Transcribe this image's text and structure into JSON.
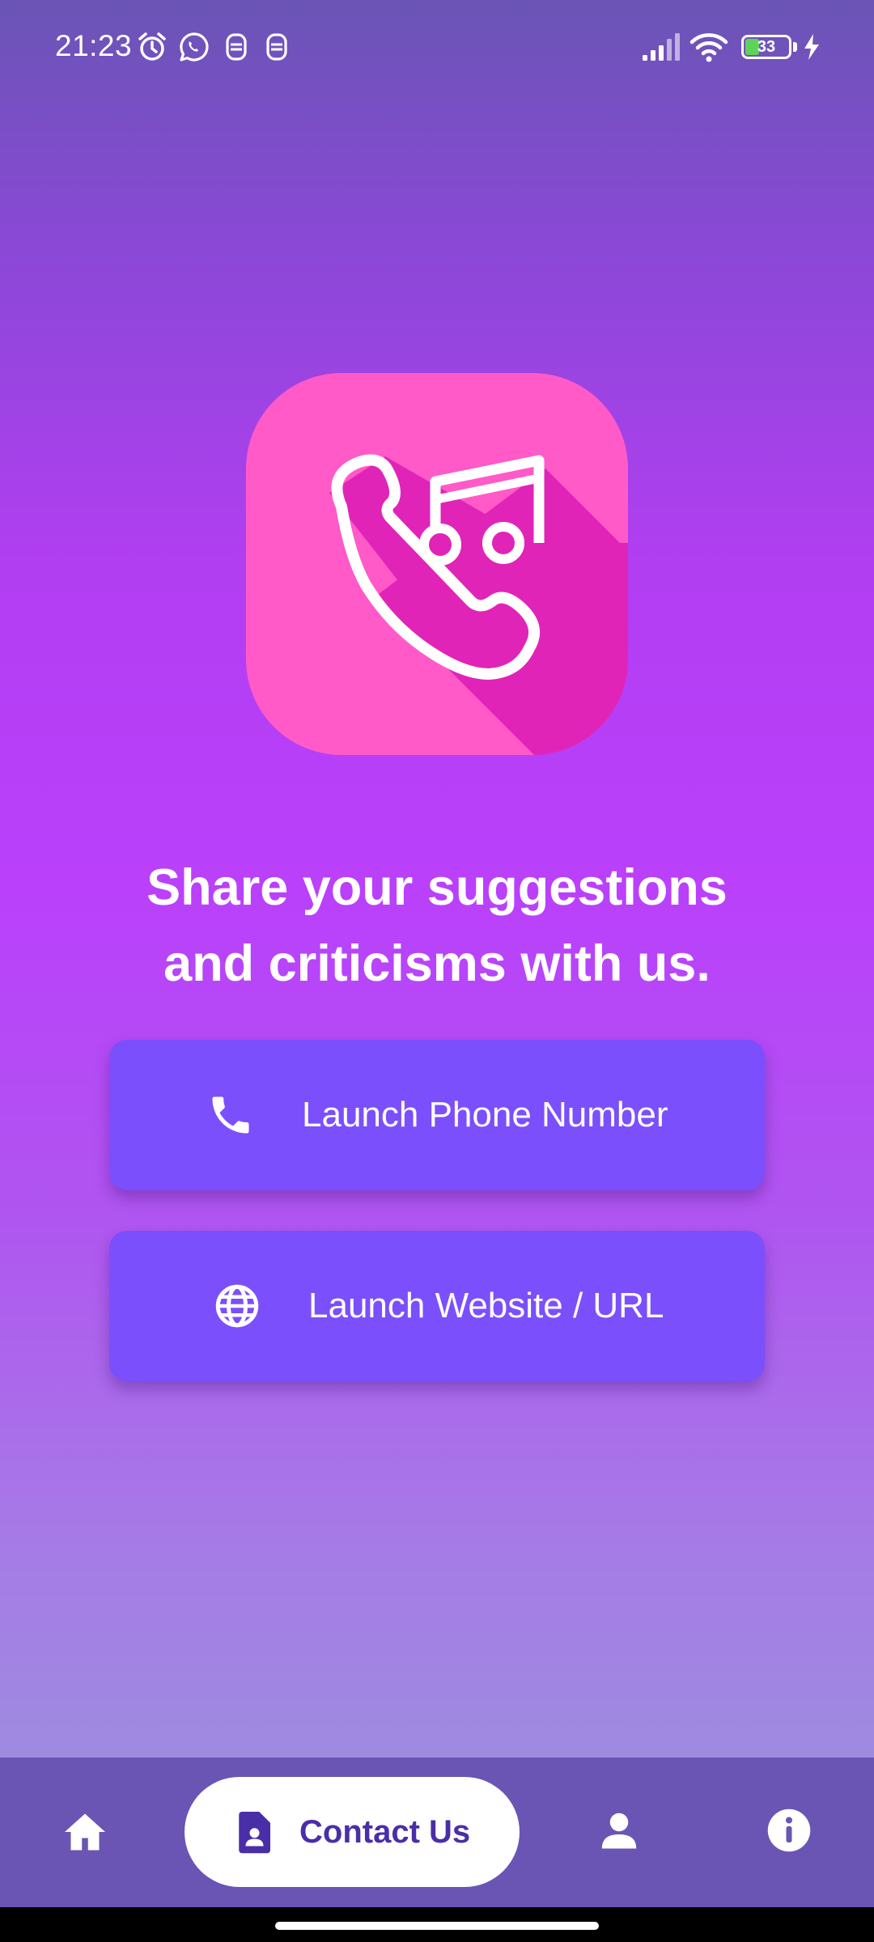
{
  "status_bar": {
    "time": "21:23",
    "battery_level": "33",
    "icons": [
      "alarm-icon",
      "whatsapp-icon",
      "sim-icon",
      "sim-icon",
      "signal-icon",
      "wifi-icon",
      "battery-icon",
      "charging-icon"
    ]
  },
  "app": {
    "logo_icon": "phone-music-logo"
  },
  "headline": {
    "line1": "Share your suggestions",
    "line2": "and criticisms with us."
  },
  "buttons": {
    "phone": {
      "label": "Launch Phone Number",
      "icon": "phone-icon"
    },
    "website": {
      "label": "Launch Website / URL",
      "icon": "globe-icon"
    }
  },
  "bottom_nav": {
    "items": [
      {
        "icon": "home-icon",
        "label": ""
      },
      {
        "icon": "contact-card-icon",
        "label": "Contact Us",
        "active": true
      },
      {
        "icon": "person-icon",
        "label": ""
      },
      {
        "icon": "info-icon",
        "label": ""
      }
    ]
  },
  "colors": {
    "background_top": "#6a55b5",
    "background_mid": "#ba40fb",
    "background_bottom": "#9e8be0",
    "logo_pink": "#ff5ac8",
    "logo_shadow": "#e024b8",
    "button": "#7b4ffc",
    "nav_bar": "#6a55b5",
    "nav_active_text": "#4a2ea8"
  }
}
